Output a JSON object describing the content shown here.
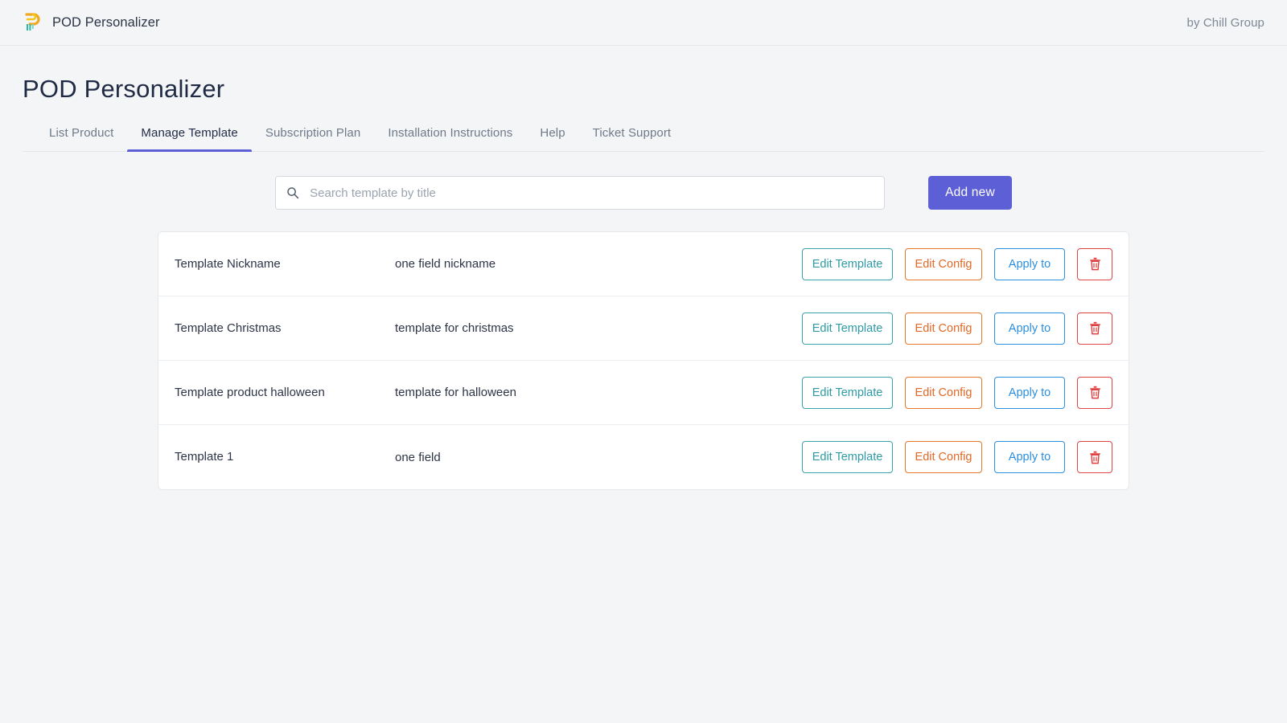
{
  "topbar": {
    "logo_icon": "pod-personalizer-logo",
    "app_name": "POD Personalizer",
    "byline": "by Chill Group"
  },
  "page": {
    "title": "POD Personalizer"
  },
  "tabs": [
    {
      "label": "List Product",
      "active": false
    },
    {
      "label": "Manage Template",
      "active": true
    },
    {
      "label": "Subscription Plan",
      "active": false
    },
    {
      "label": "Installation Instructions",
      "active": false
    },
    {
      "label": "Help",
      "active": false
    },
    {
      "label": "Ticket Support",
      "active": false
    }
  ],
  "toolbar": {
    "search_placeholder": "Search template by title",
    "search_value": "",
    "search_icon": "search-icon",
    "add_new_label": "Add new"
  },
  "table": {
    "actions": {
      "edit_template_label": "Edit Template",
      "edit_config_label": "Edit Config",
      "apply_to_label": "Apply to",
      "delete_icon": "trash-icon"
    },
    "rows": [
      {
        "name": "Template Nickname",
        "description": "one field nickname"
      },
      {
        "name": "Template Christmas",
        "description": "template for christmas"
      },
      {
        "name": "Template product halloween",
        "description": "template for halloween"
      },
      {
        "name": "Template 1",
        "description": "one field"
      }
    ]
  },
  "colors": {
    "page_background": "#f4f5f7",
    "accent_primary": "#5c5fd6",
    "edit_template": "#2f9aa4",
    "edit_config": "#e06a28",
    "apply_to": "#2b8ee0",
    "delete": "#e03c3c",
    "text_primary": "#2c3446",
    "text_muted": "#6f7a89"
  }
}
